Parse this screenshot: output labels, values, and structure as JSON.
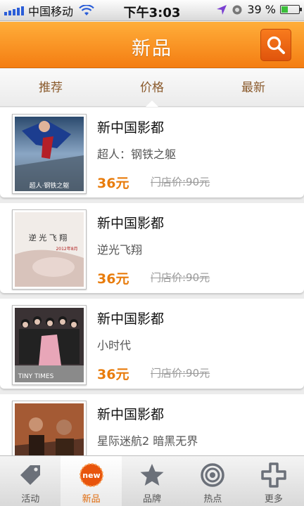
{
  "status_bar": {
    "carrier": "中国移动",
    "time": "下午3:03",
    "battery": "39 %",
    "battery_level": 0.39
  },
  "header": {
    "title": "新品"
  },
  "sort_tabs": [
    {
      "label": "推荐",
      "active": false
    },
    {
      "label": "价格",
      "active": true
    },
    {
      "label": "最新",
      "active": false
    }
  ],
  "items": [
    {
      "venue": "新中国影都",
      "movie": "超人：钢铁之躯",
      "price": "36元",
      "original_price": "门店价:90元"
    },
    {
      "venue": "新中国影都",
      "movie": "逆光飞翔",
      "price": "36元",
      "original_price": "门店价:90元"
    },
    {
      "venue": "新中国影都",
      "movie": "小时代",
      "price": "36元",
      "original_price": "门店价:90元"
    },
    {
      "venue": "新中国影都",
      "movie": "星际迷航2 暗黑无界",
      "price": "",
      "original_price": ""
    }
  ],
  "posters": [
    {
      "text": "超人·钢铁之躯"
    },
    {
      "text": "逆 光 飞 翔",
      "date": "2012年8月"
    },
    {
      "text": "TINY TIMES"
    },
    {
      "text": ""
    }
  ],
  "tab_bar": [
    {
      "label": "活动",
      "icon": "tag-icon",
      "active": false
    },
    {
      "label": "新品",
      "icon": "new-badge-icon",
      "active": true,
      "badge": "new"
    },
    {
      "label": "品牌",
      "icon": "star-icon",
      "active": false
    },
    {
      "label": "热点",
      "icon": "target-icon",
      "active": false
    },
    {
      "label": "更多",
      "icon": "plus-icon",
      "active": false
    }
  ],
  "colors": {
    "accent": "#f47d12",
    "price": "#e87c0c"
  }
}
